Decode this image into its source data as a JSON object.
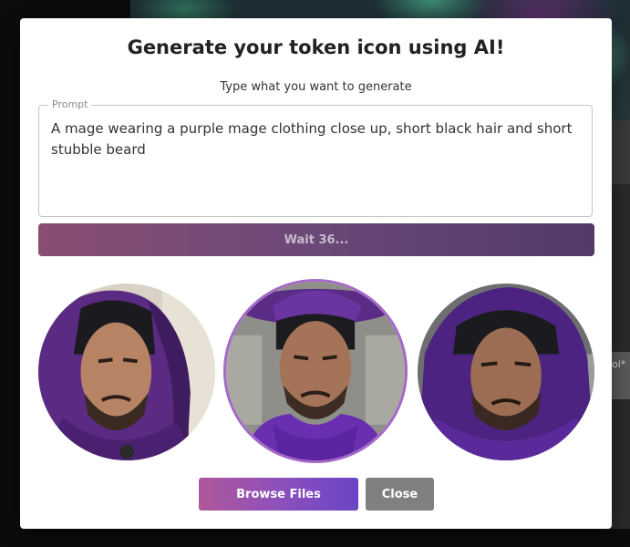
{
  "background": {
    "input_fragment": "oi*"
  },
  "modal": {
    "title": "Generate your token icon using AI!",
    "subtitle": "Type what you want to generate",
    "prompt": {
      "legend": "Prompt",
      "value": "A mage wearing a purple mage clothing close up, short black hair and short stubble beard"
    },
    "wait_label": "Wait 36...",
    "tokens": [
      {
        "name": "token-option-1",
        "selected": false
      },
      {
        "name": "token-option-2",
        "selected": true
      },
      {
        "name": "token-option-3",
        "selected": false
      }
    ],
    "browse_label": "Browse Files",
    "close_label": "Close"
  },
  "colors": {
    "selected_ring": "#a568c8",
    "browse_gradient_start": "#b0579b",
    "browse_gradient_end": "#6a44c4",
    "close_bg": "#808080",
    "wait_bg": "#6a4878"
  }
}
